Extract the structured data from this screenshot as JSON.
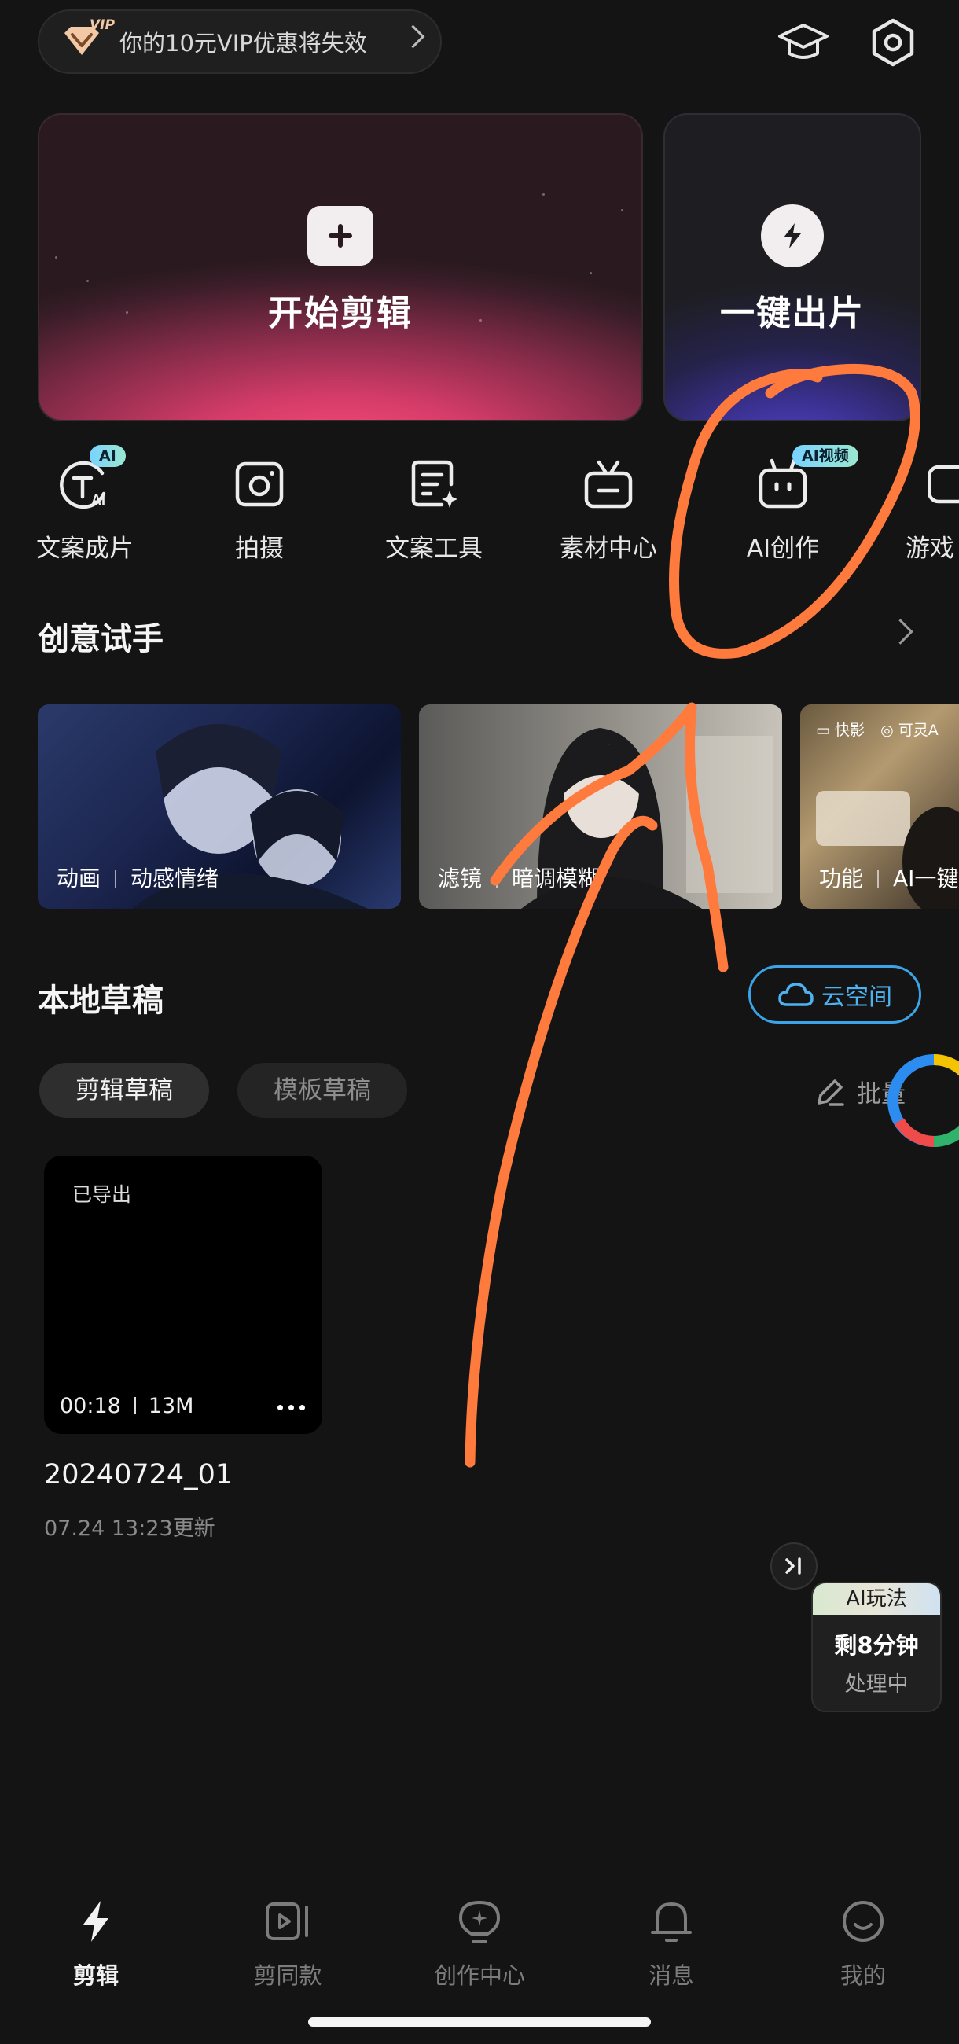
{
  "vip_banner": {
    "text": "你的10元VIP优惠将失效",
    "badge": "VIP"
  },
  "hero": {
    "start_edit": "开始剪辑",
    "one_click": "一键出片"
  },
  "shortcuts": [
    {
      "label": "文案成片",
      "badge": "AI",
      "icon": "text-to-video-icon"
    },
    {
      "label": "拍摄",
      "badge": "",
      "icon": "camera-icon"
    },
    {
      "label": "文案工具",
      "badge": "",
      "icon": "script-tool-icon"
    },
    {
      "label": "素材中心",
      "badge": "",
      "icon": "material-center-icon"
    },
    {
      "label": "AI创作",
      "badge": "AI视频",
      "icon": "robot-icon"
    },
    {
      "label": "游戏",
      "badge": "",
      "icon": "game-icon"
    }
  ],
  "creative": {
    "title": "创意试手",
    "tiles": [
      {
        "tag": "动画",
        "name": "动感情绪"
      },
      {
        "tag": "滤镜",
        "name": "暗调模糊"
      },
      {
        "tag": "功能",
        "name": "AI一键",
        "top_left": "快影",
        "top_right": "可灵A"
      }
    ]
  },
  "drafts": {
    "title": "本地草稿",
    "cloud_button": "云空间",
    "tabs": [
      "剪辑草稿",
      "模板草稿"
    ],
    "batch": "批量",
    "items": [
      {
        "status": "已导出",
        "duration": "00:18",
        "size": "13M",
        "name": "20240724_01",
        "updated": "07.24 13:23更新"
      }
    ]
  },
  "ai_float": {
    "head": "AI玩法",
    "line1": "剩8分钟",
    "line2": "处理中"
  },
  "bottom_nav": [
    {
      "label": "剪辑",
      "active": true
    },
    {
      "label": "剪同款",
      "active": false
    },
    {
      "label": "创作中心",
      "active": false
    },
    {
      "label": "消息",
      "active": false
    },
    {
      "label": "我的",
      "active": false
    }
  ],
  "colors": {
    "background": "#141414",
    "accent_blue": "#3ba4e8",
    "annotation": "#ff7a3d",
    "hero_pink": "#ff4c7a",
    "hero_purple": "#5a48d8"
  }
}
